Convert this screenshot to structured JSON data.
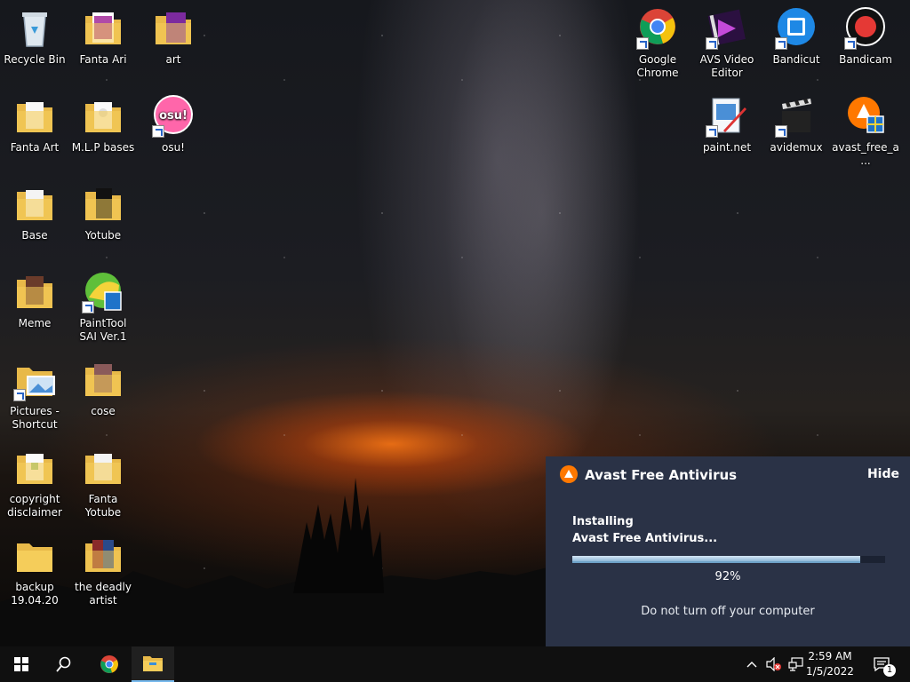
{
  "desktop": {
    "icons": [
      {
        "label": "Recycle Bin",
        "icon": "recycle-bin-icon"
      },
      {
        "label": "Fanta Ari",
        "icon": "folder-icon"
      },
      {
        "label": "art",
        "icon": "folder-icon"
      },
      {
        "label": "Fanta Art",
        "icon": "folder-icon"
      },
      {
        "label": "M.L.P bases",
        "icon": "folder-icon"
      },
      {
        "label": "osu!",
        "icon": "osu-icon",
        "badge": "osu!"
      },
      {
        "label": "Base",
        "icon": "folder-icon"
      },
      {
        "label": "Yotube",
        "icon": "folder-icon"
      },
      {
        "label": "Meme",
        "icon": "folder-icon"
      },
      {
        "label": "PaintTool SAI Ver.1",
        "icon": "painttool-sai-icon"
      },
      {
        "label": "Pictures - Shortcut",
        "icon": "folder-shortcut-icon"
      },
      {
        "label": "cose",
        "icon": "folder-icon"
      },
      {
        "label": "copyright disclaimer",
        "icon": "folder-icon"
      },
      {
        "label": "Fanta Yotube",
        "icon": "folder-icon"
      },
      {
        "label": "backup 19.04.20",
        "icon": "folder-icon"
      },
      {
        "label": "the deadly artist",
        "icon": "folder-icon"
      },
      {
        "label": "Google Chrome",
        "icon": "chrome-icon"
      },
      {
        "label": "AVS Video Editor",
        "icon": "avs-video-editor-icon"
      },
      {
        "label": "Bandicut",
        "icon": "bandicut-icon"
      },
      {
        "label": "Bandicam",
        "icon": "bandicam-icon"
      },
      {
        "label": "paint.net",
        "icon": "paint-net-icon"
      },
      {
        "label": "avidemux",
        "icon": "avidemux-icon"
      },
      {
        "label": "avast_free_a...",
        "icon": "avast-installer-icon"
      }
    ]
  },
  "avast": {
    "title": "Avast Free Antivirus",
    "hide_label": "Hide",
    "status_line1": "Installing",
    "status_line2": "Avast Free Antivirus...",
    "progress": 0.92,
    "percent_label": "92%",
    "warning": "Do not turn off your computer",
    "accent": "#ff7800"
  },
  "taskbar": {
    "time": "2:59 AM",
    "date": "1/5/2022",
    "notification_count": "1"
  }
}
